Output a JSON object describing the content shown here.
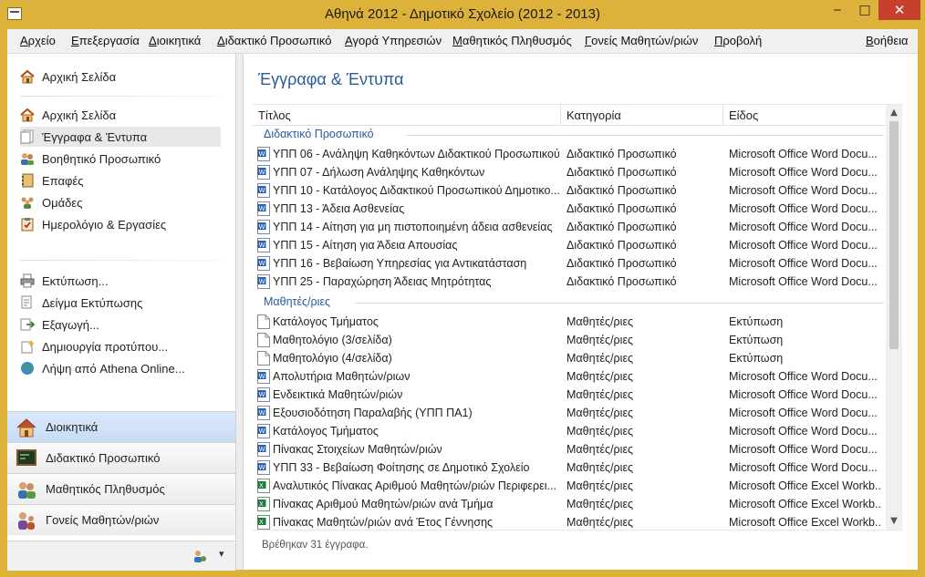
{
  "window": {
    "title": "Αθηνά 2012 - Δημοτικό Σχολείο (2012 - 2013)",
    "min": "‒",
    "max": "□",
    "close": "✕"
  },
  "menu": [
    "Αρχείο",
    "Επεξεργασία",
    "Διοικητικά",
    "Διδακτικό Προσωπικό",
    "Αγορά Υπηρεσιών",
    "Μαθητικός Πληθυσμός",
    "Γονείς Μαθητών/ριών",
    "Προβολή",
    "Βοήθεια"
  ],
  "sidebar": {
    "home_top": "Αρχική Σελίδα",
    "nav": [
      "Αρχική Σελίδα",
      "Έγγραφα & Έντυπα",
      "Βοηθητικό Προσωπικό",
      "Επαφές",
      "Ομάδες",
      "Ημερολόγιο & Εργασίες"
    ],
    "actions": [
      "Εκτύπωση...",
      "Δείγμα Εκτύπωσης",
      "Εξαγωγή...",
      "Δημιουργία προτύπου...",
      "Λήψη από Athena Online..."
    ],
    "sections": [
      "Διοικητικά",
      "Διδακτικό Προσωπικό",
      "Μαθητικός Πληθυσμός",
      "Γονείς Μαθητών/ριών"
    ],
    "bottom_arrow": "▾"
  },
  "main": {
    "heading": "Έγγραφα & Έντυπα",
    "columns": [
      "Τίτλος",
      "Κατηγορία",
      "Είδος"
    ],
    "groups": [
      {
        "name": "Διδακτικό Προσωπικό",
        "rows": [
          {
            "icon": "word",
            "title": "ΥΠΠ 06 - Ανάληψη Καθηκόντων Διδακτικού Προσωπικού",
            "cat": "Διδακτικό Προσωπικό",
            "type": "Microsoft Office Word Docu..."
          },
          {
            "icon": "word",
            "title": "ΥΠΠ 07 - Δήλωση Ανάληψης Καθηκόντων",
            "cat": "Διδακτικό Προσωπικό",
            "type": "Microsoft Office Word Docu..."
          },
          {
            "icon": "word",
            "title": "ΥΠΠ 10 - Κατάλογος Διδακτικού Προσωπικού Δημοτικο...",
            "cat": "Διδακτικό Προσωπικό",
            "type": "Microsoft Office Word Docu..."
          },
          {
            "icon": "word",
            "title": "ΥΠΠ 13 - Άδεια Ασθενείας",
            "cat": "Διδακτικό Προσωπικό",
            "type": "Microsoft Office Word Docu..."
          },
          {
            "icon": "word",
            "title": "ΥΠΠ 14 - Αίτηση για μη πιστοποιημένη άδεια ασθενείας",
            "cat": "Διδακτικό Προσωπικό",
            "type": "Microsoft Office Word Docu..."
          },
          {
            "icon": "word",
            "title": "ΥΠΠ 15 - Αίτηση για Άδεια Απουσίας",
            "cat": "Διδακτικό Προσωπικό",
            "type": "Microsoft Office Word Docu..."
          },
          {
            "icon": "word",
            "title": "ΥΠΠ 16 - Βεβαίωση Υπηρεσίας για Αντικατάσταση",
            "cat": "Διδακτικό Προσωπικό",
            "type": "Microsoft Office Word Docu..."
          },
          {
            "icon": "word",
            "title": "ΥΠΠ 25 - Παραχώρηση Άδειας Μητρότητας",
            "cat": "Διδακτικό Προσωπικό",
            "type": "Microsoft Office Word Docu..."
          }
        ]
      },
      {
        "name": "Μαθητές/ριες",
        "rows": [
          {
            "icon": "page",
            "title": "Κατάλογος Τμήματος",
            "cat": "Μαθητές/ριες",
            "type": "Εκτύπωση"
          },
          {
            "icon": "page",
            "title": "Μαθητολόγιο (3/σελίδα)",
            "cat": "Μαθητές/ριες",
            "type": "Εκτύπωση"
          },
          {
            "icon": "page",
            "title": "Μαθητολόγιο (4/σελίδα)",
            "cat": "Μαθητές/ριες",
            "type": "Εκτύπωση"
          },
          {
            "icon": "word",
            "title": "Απολυτήρια Μαθητών/ριων",
            "cat": "Μαθητές/ριες",
            "type": "Microsoft Office Word Docu..."
          },
          {
            "icon": "word",
            "title": "Ενδεικτικά Μαθητών/ριών",
            "cat": "Μαθητές/ριες",
            "type": "Microsoft Office Word Docu..."
          },
          {
            "icon": "word",
            "title": "Εξουσιοδότηση Παραλαβής (ΥΠΠ ΠΑ1)",
            "cat": "Μαθητές/ριες",
            "type": "Microsoft Office Word Docu..."
          },
          {
            "icon": "word",
            "title": "Κατάλογος Τμήματος",
            "cat": "Μαθητές/ριες",
            "type": "Microsoft Office Word Docu..."
          },
          {
            "icon": "word",
            "title": "Πίνακας Στοιχείων Μαθητών/ριών",
            "cat": "Μαθητές/ριες",
            "type": "Microsoft Office Word Docu..."
          },
          {
            "icon": "word",
            "title": "ΥΠΠ 33 - Βεβαίωση Φοίτησης σε Δημοτικό Σχολείο",
            "cat": "Μαθητές/ριες",
            "type": "Microsoft Office Word Docu..."
          },
          {
            "icon": "excel",
            "title": "Αναλυτικός Πίνακας Αριθμού Μαθητών/ριών Περιφερει...",
            "cat": "Μαθητές/ριες",
            "type": "Microsoft Office Excel Workb..."
          },
          {
            "icon": "excel",
            "title": "Πίνακας Αριθμού Μαθητών/ριών ανά Τμήμα",
            "cat": "Μαθητές/ριες",
            "type": "Microsoft Office Excel Workb..."
          },
          {
            "icon": "excel",
            "title": "Πίνακας Μαθητών/ριών ανά Έτος Γέννησης",
            "cat": "Μαθητές/ριες",
            "type": "Microsoft Office Excel Workb..."
          }
        ]
      }
    ],
    "status": "Βρέθηκαν 31 έγγραφα."
  }
}
